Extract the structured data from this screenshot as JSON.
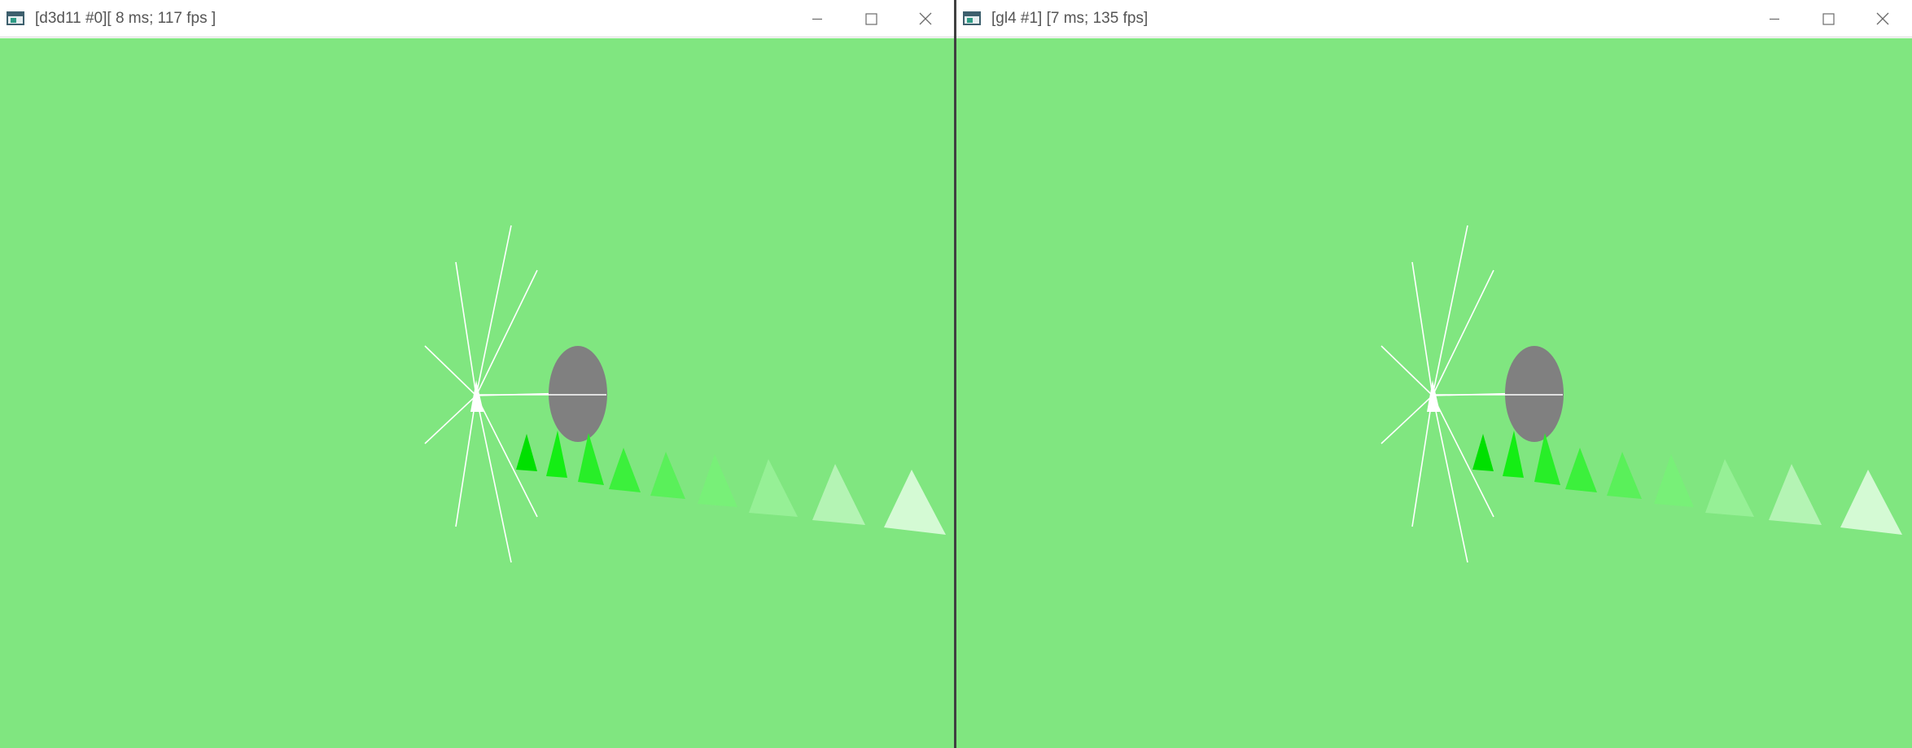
{
  "windows": [
    {
      "title": "[d3d11 #0][ 8 ms; 117 fps ]",
      "icon": "app-window-icon",
      "controls": [
        "minimize-icon",
        "maximize-icon",
        "close-icon"
      ],
      "scene_background": "#80e680"
    },
    {
      "title": "[gl4 #1] [7 ms; 135 fps]",
      "icon": "app-window-icon",
      "controls": [
        "minimize-icon",
        "maximize-icon",
        "close-icon"
      ],
      "scene_background": "#80e680"
    }
  ],
  "scene": {
    "ellipse_color": "#808080",
    "spokes_color": "#ffffff",
    "marker_color": "#ffffff",
    "triangle_colors": [
      "#00e000",
      "#14ee14",
      "#28ee28",
      "#3cf03c",
      "#5af05a",
      "#78f078",
      "#96f096",
      "#b4f4b4",
      "#d4fad4"
    ]
  }
}
